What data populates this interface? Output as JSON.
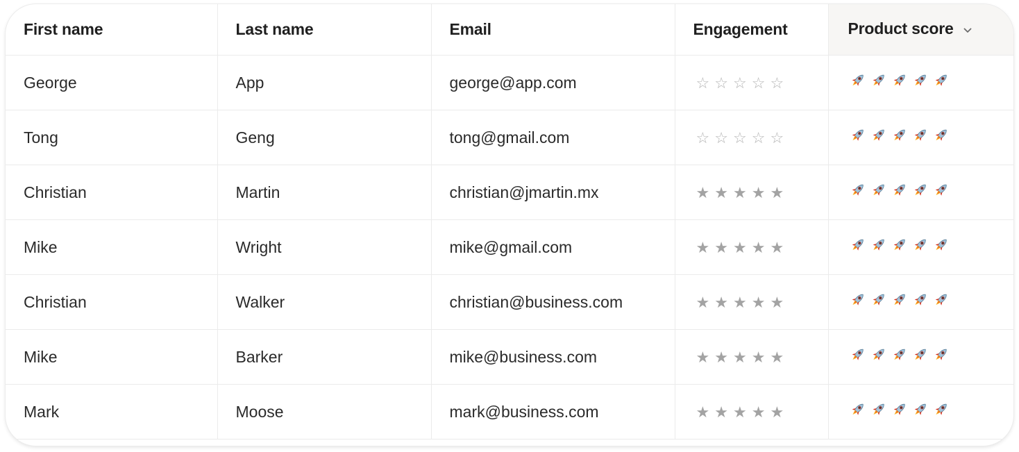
{
  "table": {
    "columns": [
      {
        "key": "first_name",
        "label": "First name"
      },
      {
        "key": "last_name",
        "label": "Last name"
      },
      {
        "key": "email",
        "label": "Email"
      },
      {
        "key": "engagement",
        "label": "Engagement"
      },
      {
        "key": "product_score",
        "label": "Product score",
        "sorted": true,
        "sort_icon": "chevron-down-icon"
      }
    ],
    "rows": [
      {
        "first_name": "George",
        "last_name": "App",
        "email": "george@app.com",
        "engagement": 0,
        "product_score": 5
      },
      {
        "first_name": "Tong",
        "last_name": "Geng",
        "email": "tong@gmail.com",
        "engagement": 0,
        "product_score": 5
      },
      {
        "first_name": "Christian",
        "last_name": "Martin",
        "email": "christian@jmartin.mx",
        "engagement": 5,
        "product_score": 5
      },
      {
        "first_name": "Mike",
        "last_name": "Wright",
        "email": "mike@gmail.com",
        "engagement": 5,
        "product_score": 5
      },
      {
        "first_name": "Christian",
        "last_name": "Walker",
        "email": "christian@business.com",
        "engagement": 5,
        "product_score": 5
      },
      {
        "first_name": "Mike",
        "last_name": "Barker",
        "email": "mike@business.com",
        "engagement": 5,
        "product_score": 5
      },
      {
        "first_name": "Mark",
        "last_name": "Moose",
        "email": "mark@business.com",
        "engagement": 5,
        "product_score": 5
      }
    ],
    "max_rating": 5,
    "icons": {
      "engagement": "star-icon",
      "product_score": "rocket-icon"
    },
    "colors": {
      "star_filled": "#a3a3a3",
      "star_empty": "#b5b5b5",
      "sorted_header_bg": "#f7f6f4",
      "grid_line": "#ebebeb"
    }
  }
}
